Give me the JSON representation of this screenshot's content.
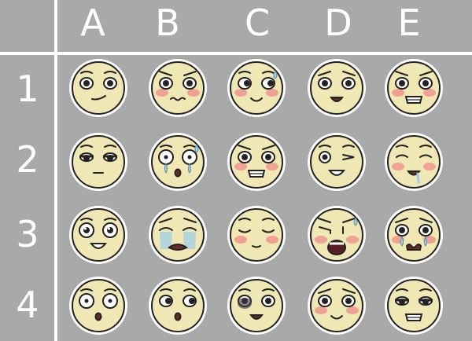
{
  "chart_title": "",
  "columns": [
    "A",
    "B",
    "C",
    "D",
    "E"
  ],
  "rows": [
    "1",
    "2",
    "3",
    "4"
  ],
  "colors": {
    "background": "#a9a9a9",
    "grid": "#ffffff",
    "skin": "#efe7b4",
    "outline": "#222222",
    "halo": "#ffffff",
    "blush": "#f08a8a",
    "eye_white": "#ffffff",
    "tear": "#9fd0e8"
  },
  "faces": [
    {
      "cell": "A1",
      "expression": "smug-skeptical",
      "blush": false,
      "tears": false,
      "sweat": false,
      "eyes": "narrow",
      "mouth": "smirk"
    },
    {
      "cell": "B1",
      "expression": "annoyed-blush",
      "blush": true,
      "tears": false,
      "sweat": false,
      "eyes": "angry",
      "mouth": "wavy"
    },
    {
      "cell": "C1",
      "expression": "nervous-smile",
      "blush": true,
      "tears": false,
      "sweat": true,
      "eyes": "side",
      "mouth": "smile"
    },
    {
      "cell": "D1",
      "expression": "worried",
      "blush": false,
      "tears": false,
      "sweat": false,
      "eyes": "sad",
      "mouth": "open-small"
    },
    {
      "cell": "E1",
      "expression": "flustered-grin",
      "blush": true,
      "tears": false,
      "sweat": false,
      "eyes": "angry",
      "mouth": "teeth"
    },
    {
      "cell": "A2",
      "expression": "tired",
      "blush": false,
      "tears": false,
      "sweat": false,
      "eyes": "halflid",
      "mouth": "flat"
    },
    {
      "cell": "B2",
      "expression": "teary-shocked",
      "blush": false,
      "tears": true,
      "sweat": true,
      "eyes": "wide",
      "mouth": "small-o"
    },
    {
      "cell": "C2",
      "expression": "angry-blush",
      "blush": true,
      "tears": false,
      "sweat": false,
      "eyes": "angry",
      "mouth": "teeth"
    },
    {
      "cell": "D2",
      "expression": "wink",
      "blush": false,
      "tears": false,
      "sweat": false,
      "eyes": "wink",
      "mouth": "grin-open"
    },
    {
      "cell": "E2",
      "expression": "drooling-blush",
      "blush": true,
      "tears": false,
      "sweat": false,
      "eyes": "closed-happy",
      "mouth": "drool"
    },
    {
      "cell": "A3",
      "expression": "hopeful",
      "blush": false,
      "tears": false,
      "sweat": false,
      "eyes": "sparkle",
      "mouth": "grin"
    },
    {
      "cell": "B3",
      "expression": "crying",
      "blush": false,
      "tears": true,
      "sweat": false,
      "eyes": "crying",
      "mouth": "wail"
    },
    {
      "cell": "C3",
      "expression": "content",
      "blush": true,
      "tears": false,
      "sweat": false,
      "eyes": "closed",
      "mouth": "smile-small"
    },
    {
      "cell": "D3",
      "expression": "screaming",
      "blush": true,
      "tears": false,
      "sweat": true,
      "eyes": "squeezed",
      "mouth": "scream"
    },
    {
      "cell": "E3",
      "expression": "blushing-teary",
      "blush": true,
      "tears": true,
      "sweat": false,
      "eyes": "sad",
      "mouth": "wavy-open"
    },
    {
      "cell": "A4",
      "expression": "shocked",
      "blush": false,
      "tears": false,
      "sweat": false,
      "eyes": "wide",
      "mouth": "small-o"
    },
    {
      "cell": "B4",
      "expression": "surprised",
      "blush": false,
      "tears": false,
      "sweat": false,
      "eyes": "side",
      "mouth": "small-o"
    },
    {
      "cell": "C4",
      "expression": "bruised",
      "blush": false,
      "tears": false,
      "sweat": false,
      "eyes": "bruised",
      "mouth": "open-small"
    },
    {
      "cell": "D4",
      "expression": "sheepish",
      "blush": true,
      "tears": false,
      "sweat": false,
      "eyes": "sad",
      "mouth": "smile"
    },
    {
      "cell": "E4",
      "expression": "disgusted",
      "blush": false,
      "tears": false,
      "sweat": false,
      "eyes": "halflid",
      "mouth": "teeth"
    }
  ]
}
